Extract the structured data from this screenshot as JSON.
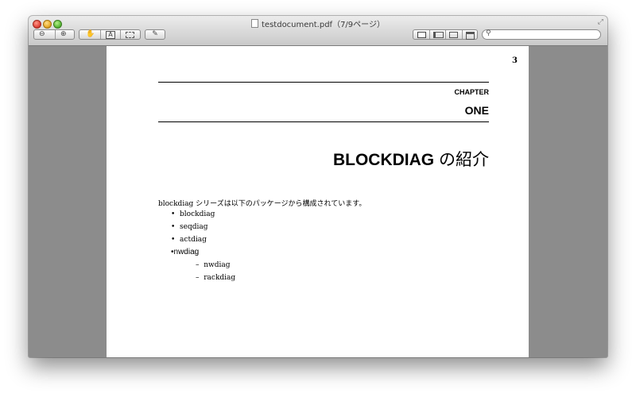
{
  "window": {
    "title": "testdocument.pdf（7/9ページ）"
  },
  "toolbar": {
    "zoom_out_icon": "zoom-out-icon",
    "zoom_in_icon": "zoom-in-icon",
    "hand_tool_icon": "hand-icon",
    "text_tool_label": "A",
    "select_tool_icon": "rectangle-select-icon",
    "annotate_icon": "pencil-icon",
    "view_modes": [
      "single-page-icon",
      "sidebar-view-icon",
      "two-page-icon",
      "contact-sheet-icon"
    ],
    "search_placeholder": ""
  },
  "document": {
    "page_number": "3",
    "chapter_label": "CHAPTER",
    "chapter_number": "ONE",
    "heading_bold": "BLOCKDIAG",
    "heading_rest": " の紹介",
    "intro": "blockdiag シリーズは以下のパッケージから構成されています。",
    "packages": [
      {
        "bullet": "•",
        "name": "blockdiag"
      },
      {
        "bullet": "•",
        "name": "seqdiag"
      },
      {
        "bullet": "•",
        "name": "actdiag"
      },
      {
        "bullet": "•",
        "name": "nwdiag"
      }
    ],
    "sub_packages": [
      {
        "bullet": "–",
        "name": "nwdiag"
      },
      {
        "bullet": "–",
        "name": "rackdiag"
      }
    ]
  }
}
